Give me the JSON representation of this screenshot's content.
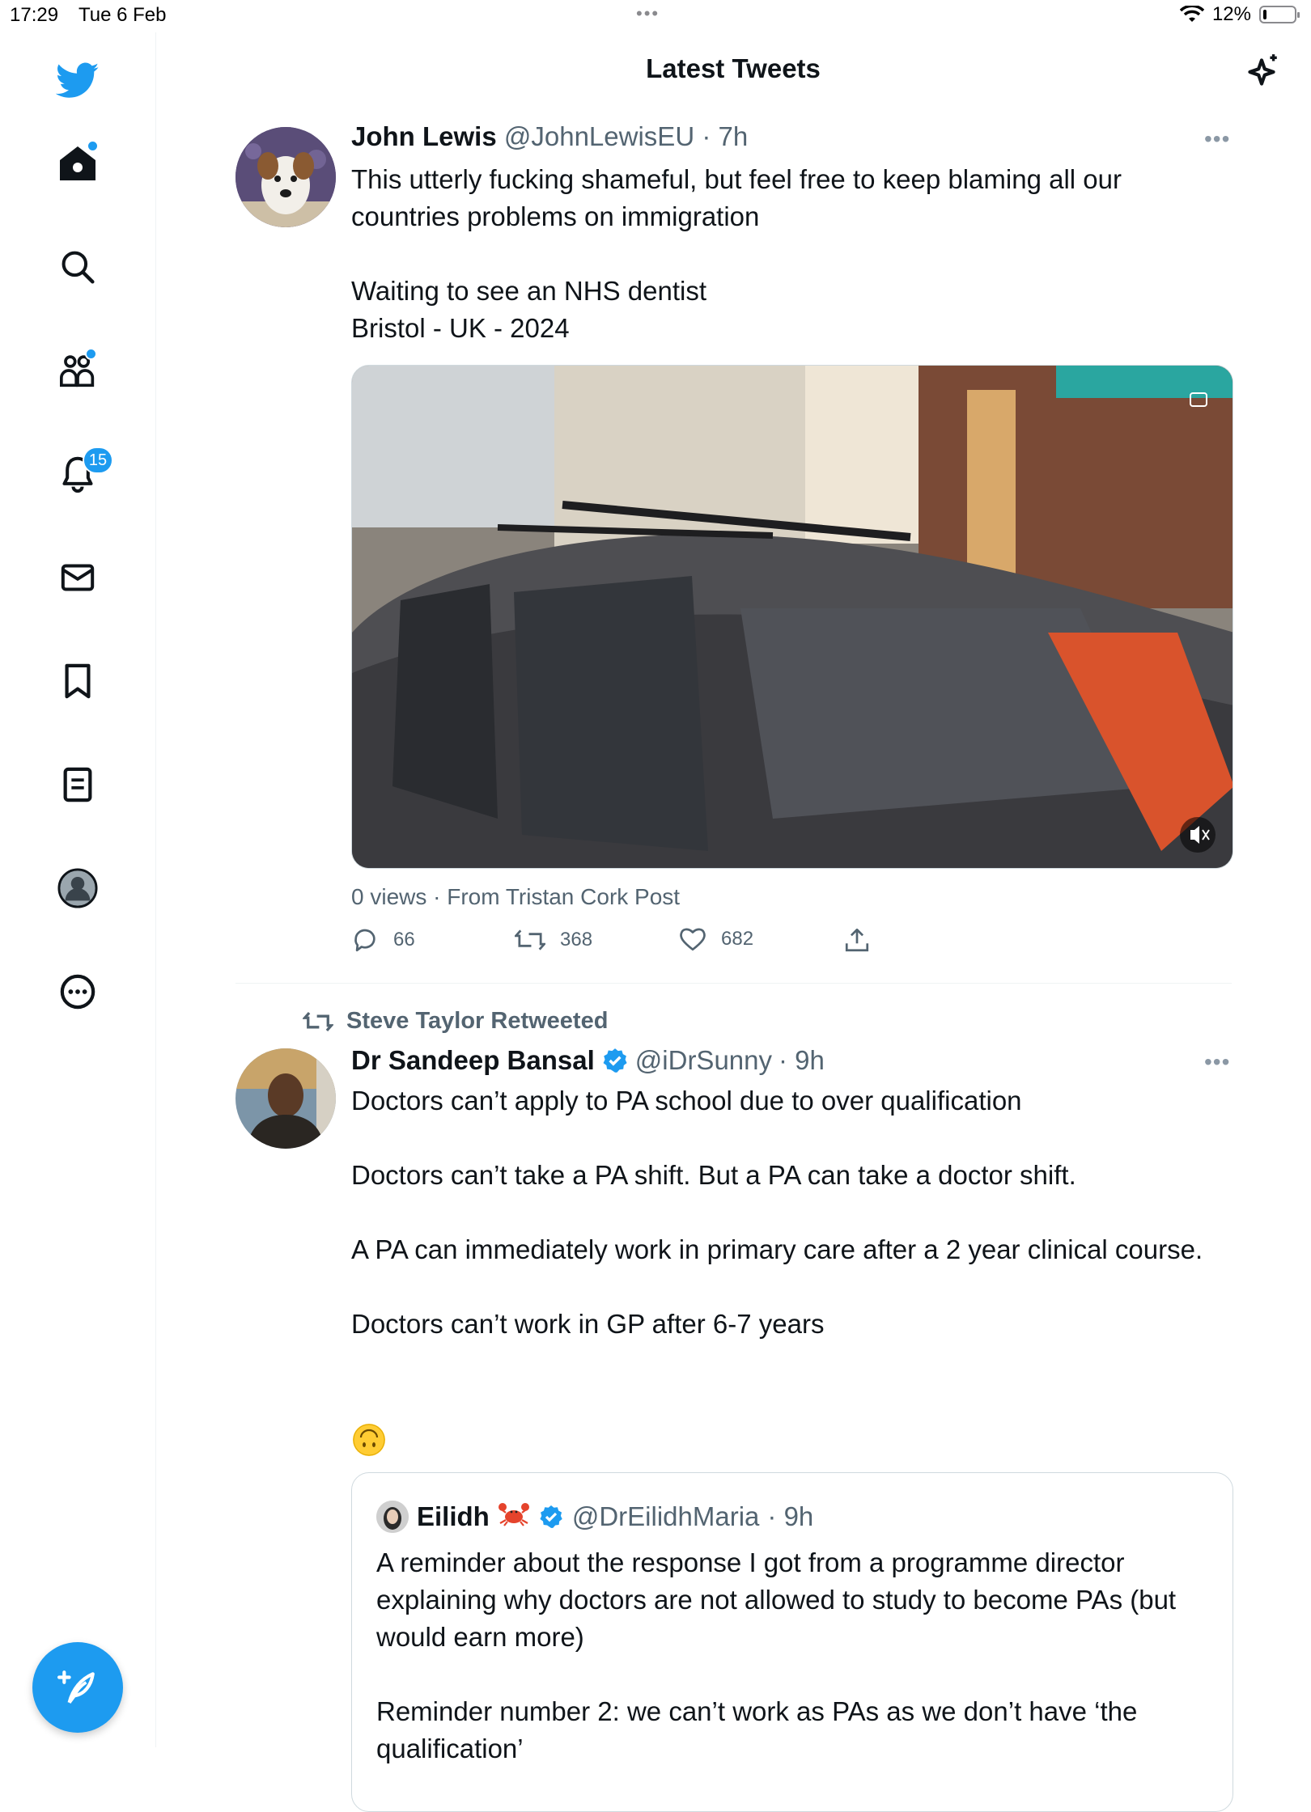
{
  "status_bar": {
    "time": "17:29",
    "date": "Tue 6 Feb",
    "battery": "12%",
    "battery_level": 0.12
  },
  "header": {
    "title": "Latest Tweets"
  },
  "nav": {
    "items": [
      "twitter-logo",
      "home",
      "search",
      "communities",
      "notifications",
      "messages",
      "bookmarks",
      "lists",
      "profile",
      "more"
    ],
    "notifications_badge": "15"
  },
  "tweets": [
    {
      "name": "John Lewis",
      "handle": "@JohnLewisEU",
      "time": "· 7h",
      "text": "This utterly fucking shameful, but feel free to keep blaming all our countries problems on immigration\n\nWaiting to see an NHS dentist\nBristol - UK - 2024",
      "views": "0 views · From Tristan Cork Post",
      "replies": "66",
      "retweets": "368",
      "likes": "682"
    },
    {
      "retweeted_by": "Steve Taylor Retweeted",
      "name": "Dr Sandeep Bansal",
      "handle": "@iDrSunny",
      "time": "· 9h",
      "text": "Doctors can’t apply to PA school due to over qualification\n\nDoctors can’t take a PA shift. But a PA can take a doctor shift.\n\nA PA can immediately work in primary care after a 2 year clinical course.\n\nDoctors can’t work in GP after 6-7 years",
      "quote": {
        "name": "Eilidh",
        "emoji": "🦀",
        "handle": "@DrEilidhMaria",
        "time": "· 9h",
        "text": "A reminder about the response I got from a programme director explaining why doctors are not allowed to study to become PAs (but would earn more)\n\nReminder number 2: we can’t work as PAs as we don’t have ‘the qualification’"
      }
    }
  ],
  "colors": {
    "accent": "#1d9bf0",
    "text": "#0f1419",
    "secondary": "#536471",
    "border": "#cfd9de"
  }
}
